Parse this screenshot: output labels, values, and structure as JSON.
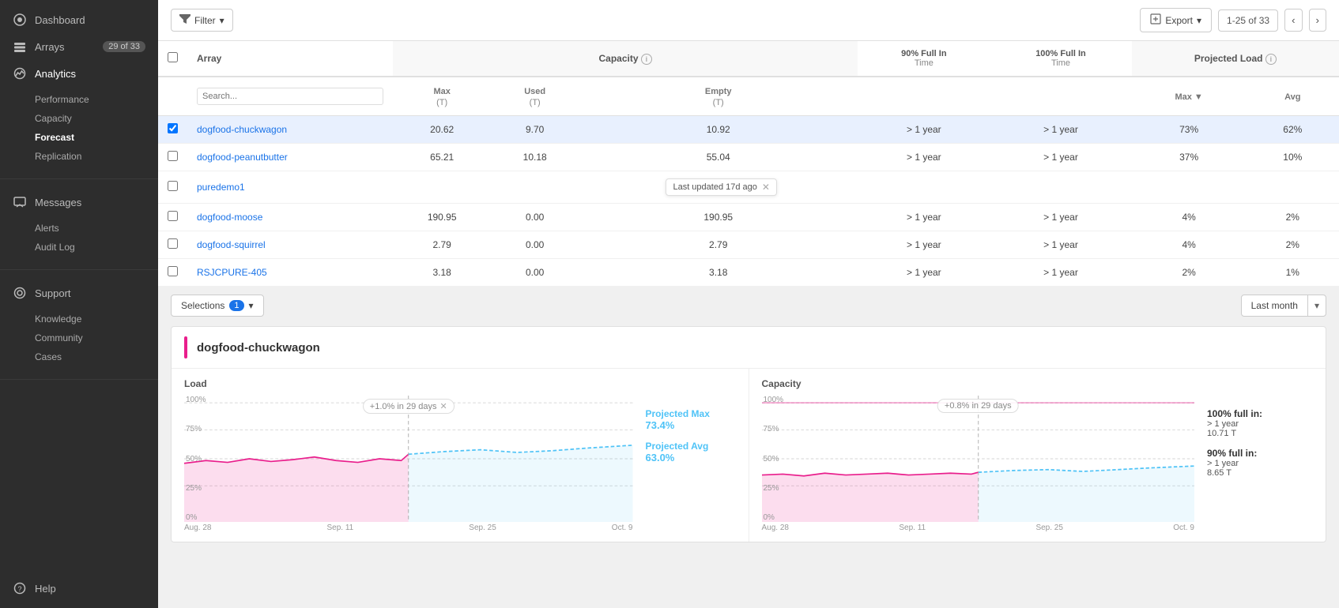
{
  "sidebar": {
    "dashboard_label": "Dashboard",
    "arrays_label": "Arrays",
    "arrays_badge": "29 of 33",
    "analytics_label": "Analytics",
    "performance_label": "Performance",
    "capacity_label": "Capacity",
    "forecast_label": "Forecast",
    "replication_label": "Replication",
    "messages_label": "Messages",
    "alerts_label": "Alerts",
    "audit_log_label": "Audit Log",
    "support_label": "Support",
    "knowledge_label": "Knowledge",
    "community_label": "Community",
    "cases_label": "Cases",
    "help_label": "Help"
  },
  "toolbar": {
    "filter_label": "Filter",
    "export_label": "Export",
    "pagination": "1-25 of 33"
  },
  "table": {
    "headers": {
      "array": "Array",
      "capacity": "Capacity",
      "capacity_info": true,
      "max_t": "Max (T)",
      "used_t": "Used (T)",
      "empty_t": "Empty (T)",
      "full_in_90": "90% Full In Time",
      "full_in_100": "100% Full In Time",
      "projected_load": "Projected Load",
      "projected_load_info": true,
      "proj_max": "Max",
      "proj_avg": "Avg"
    },
    "rows": [
      {
        "id": "dogfood-chuckwagon",
        "checked": true,
        "max": "20.62",
        "used": "9.70",
        "empty": "10.92",
        "full90": "> 1 year",
        "full100": "> 1 year",
        "proj_max": "73%",
        "proj_avg": "62%"
      },
      {
        "id": "dogfood-peanutbutter",
        "checked": false,
        "max": "65.21",
        "used": "10.18",
        "empty": "55.04",
        "full90": "> 1 year",
        "full100": "> 1 year",
        "proj_max": "37%",
        "proj_avg": "10%"
      },
      {
        "id": "puredemo1",
        "checked": false,
        "max": "",
        "used": "",
        "empty": "",
        "full90": "",
        "full100": "",
        "proj_max": "",
        "proj_avg": "",
        "tooltip": "Last updated 17d ago"
      },
      {
        "id": "dogfood-moose",
        "checked": false,
        "max": "190.95",
        "used": "0.00",
        "empty": "190.95",
        "full90": "> 1 year",
        "full100": "> 1 year",
        "proj_max": "4%",
        "proj_avg": "2%"
      },
      {
        "id": "dogfood-squirrel",
        "checked": false,
        "max": "2.79",
        "used": "0.00",
        "empty": "2.79",
        "full90": "> 1 year",
        "full100": "> 1 year",
        "proj_max": "4%",
        "proj_avg": "2%"
      },
      {
        "id": "RSJCPURE-405",
        "checked": false,
        "max": "3.18",
        "used": "0.00",
        "empty": "3.18",
        "full90": "> 1 year",
        "full100": "> 1 year",
        "proj_max": "2%",
        "proj_avg": "1%"
      }
    ]
  },
  "bottom": {
    "selections_label": "Selections",
    "selections_count": "1",
    "timerange_label": "Last month",
    "array_title": "dogfood-chuckwagon",
    "load_chart": {
      "label": "Load",
      "annotation": "+1.0% in 29 days",
      "projected_max_label": "Projected Max",
      "projected_max_val": "73.4%",
      "projected_avg_label": "Projected Avg",
      "projected_avg_val": "63.0%",
      "x_labels": [
        "Aug. 28",
        "Sep. 11",
        "Sep. 25",
        "Oct. 9"
      ],
      "y_labels": [
        "100%",
        "75%",
        "50%",
        "25%",
        "0%"
      ]
    },
    "capacity_chart": {
      "label": "Capacity",
      "annotation": "+0.8% in 29 days",
      "full_100_label": "100% full in:",
      "full_100_sub": "> 1 year",
      "full_100_val": "10.71 T",
      "full_90_label": "90% full in:",
      "full_90_sub": "> 1 year",
      "full_90_val": "8.65 T",
      "x_labels": [
        "Aug. 28",
        "Sep. 11",
        "Sep. 25",
        "Oct. 9"
      ],
      "y_labels": [
        "100%",
        "75%",
        "50%",
        "25%",
        "0%"
      ]
    }
  }
}
